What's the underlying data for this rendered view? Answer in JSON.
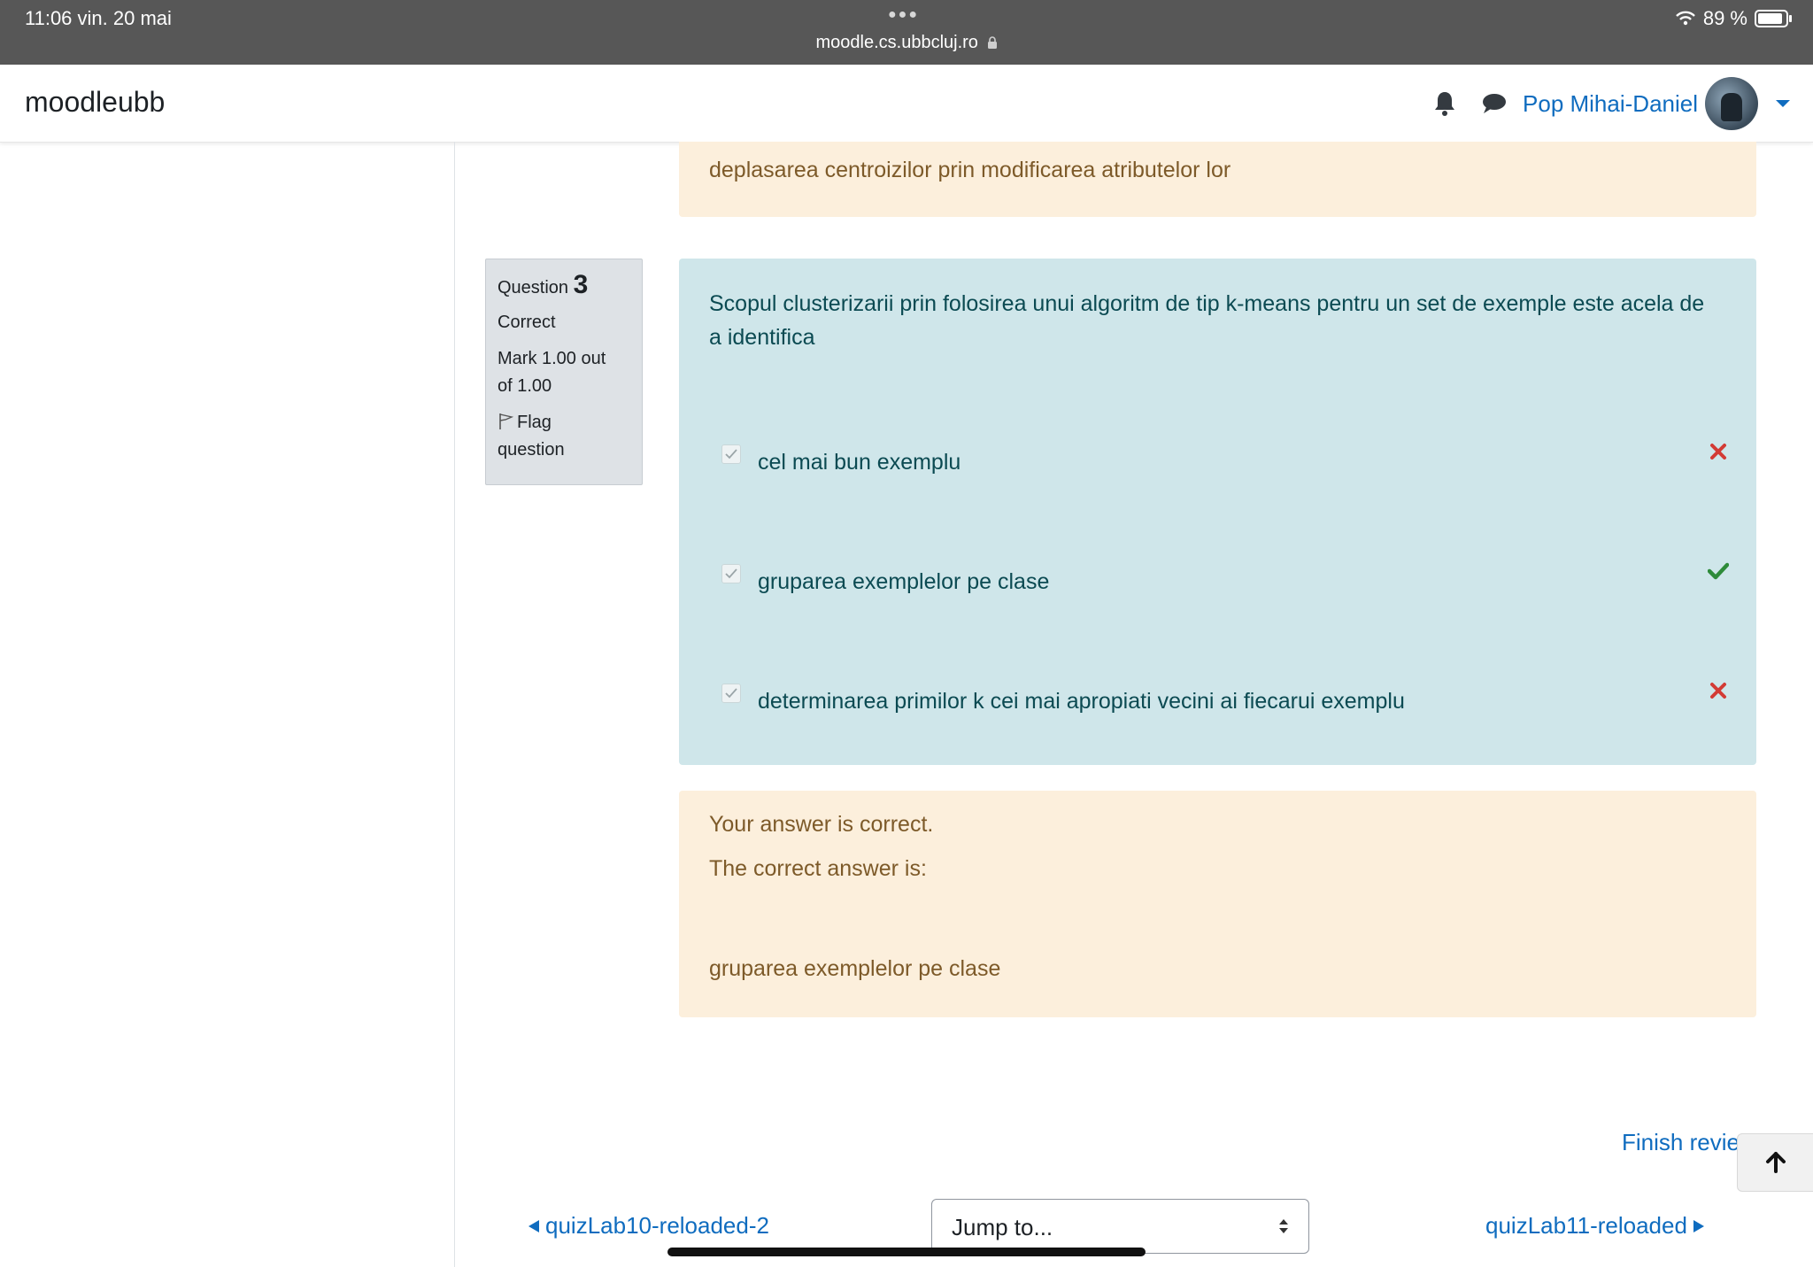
{
  "statusbar": {
    "time": "11:06   vin. 20 mai",
    "url": "moodle.cs.ubbcluj.ro",
    "battery": "89 %"
  },
  "navbar": {
    "brand": "moodleubb",
    "username": "Pop Mihai-Daniel"
  },
  "previous_answer": {
    "text": "deplasarea centroizilor prin modificarea atributelor lor"
  },
  "question": {
    "label": "Question",
    "number": "3",
    "state": "Correct",
    "mark": "Mark 1.00 out of 1.00",
    "flag_label": "Flag question",
    "text": "Scopul clusterizarii prin folosirea unui algoritm de tip k-means pentru un set de exemple este acela de a identifica",
    "answers": [
      {
        "label": "cel mai bun exemplu",
        "checked": true,
        "result": "incorrect"
      },
      {
        "label": "gruparea exemplelor pe clase",
        "checked": true,
        "result": "correct"
      },
      {
        "label": "determinarea primilor k cei mai apropiati vecini ai fiecarui exemplu",
        "checked": true,
        "result": "incorrect"
      }
    ]
  },
  "feedback": {
    "status": "Your answer is correct.",
    "correct_intro": "The correct answer is:",
    "correct_answer": "gruparea exemplelor pe clase"
  },
  "navigation": {
    "finish_review": "Finish review",
    "prev_activity": "quizLab10-reloaded-2",
    "jump_to": "Jump to...",
    "next_activity": "quizLab11-reloaded"
  },
  "colors": {
    "link": "#0f6cbf",
    "question_bg": "#cfe6ea",
    "feedback_bg": "#fcefdc",
    "correct": "#2e8b3a",
    "incorrect": "#d33b35"
  }
}
